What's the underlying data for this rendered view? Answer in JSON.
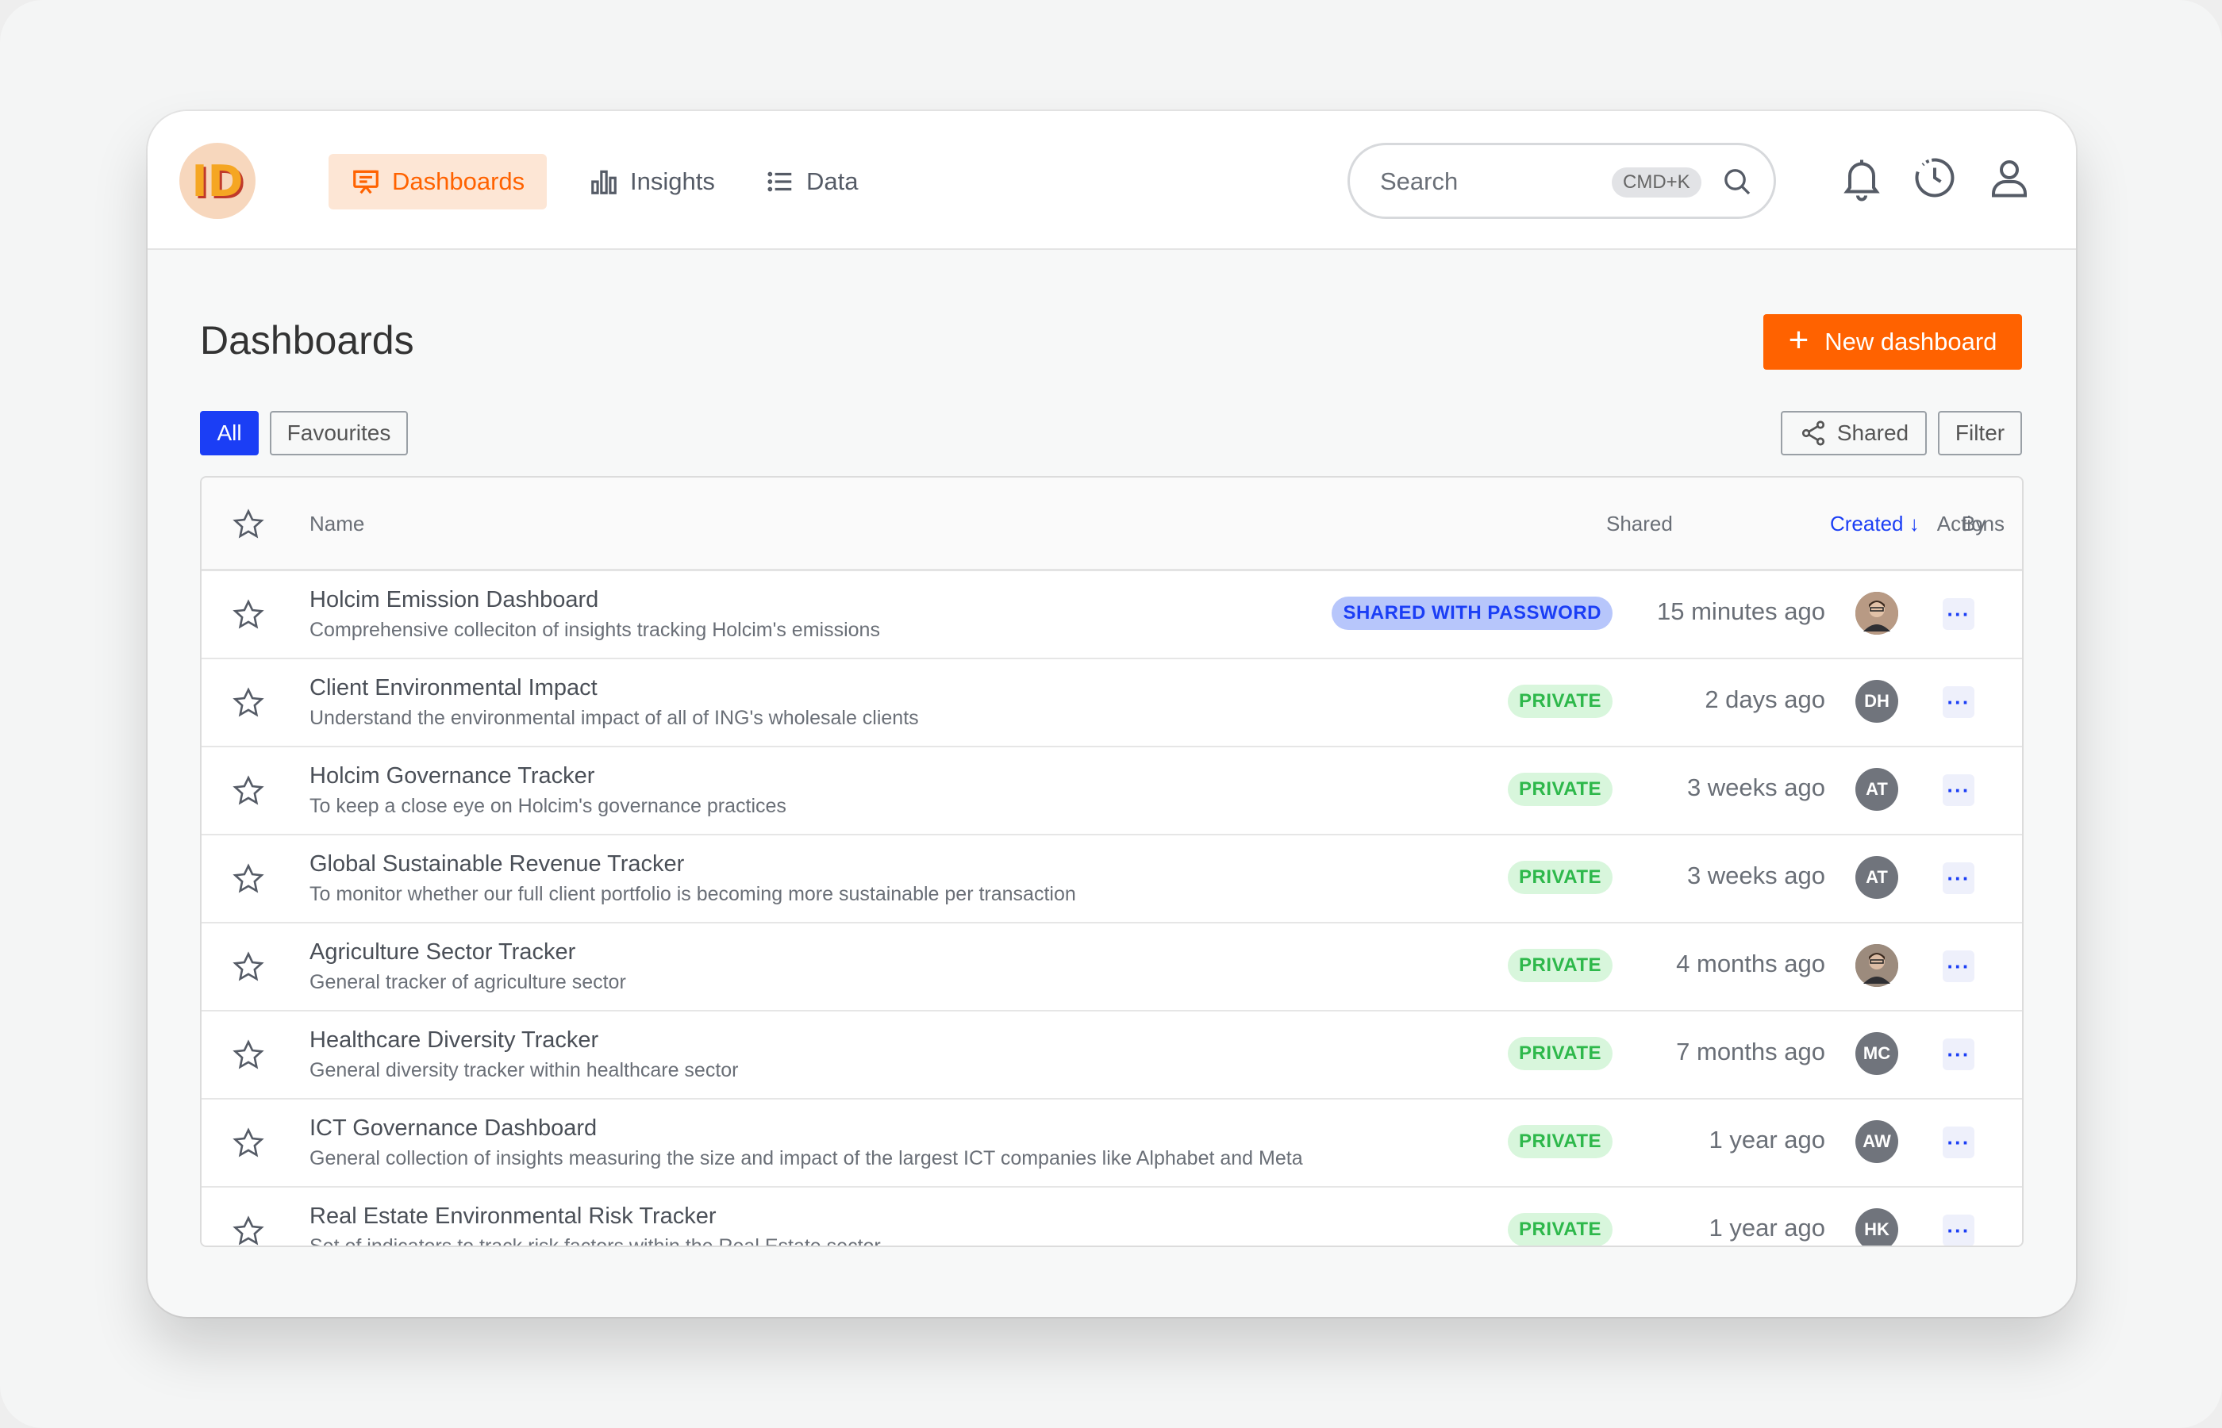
{
  "app": {
    "logo_text": "ID"
  },
  "nav": {
    "items": [
      {
        "label": "Dashboards",
        "icon": "presentation-icon",
        "active": true
      },
      {
        "label": "Insights",
        "icon": "bar-chart-icon",
        "active": false
      },
      {
        "label": "Data",
        "icon": "list-icon",
        "active": false
      }
    ]
  },
  "search": {
    "placeholder": "Search",
    "shortcut": "CMD+K"
  },
  "page": {
    "title": "Dashboards",
    "new_button": "New dashboard",
    "filters": {
      "all": "All",
      "favourites": "Favourites",
      "shared": "Shared",
      "filter": "Filter"
    }
  },
  "table": {
    "columns": {
      "name": "Name",
      "shared": "Shared",
      "created": "Created",
      "by": "By",
      "actions": "Actions"
    },
    "sort": {
      "column": "Created",
      "direction": "descending"
    },
    "rows": [
      {
        "title": "Holcim Emission Dashboard",
        "desc": "Comprehensive colleciton of insights tracking Holcim's emissions",
        "shared": "SHARED WITH PASSWORD",
        "created": "15 minutes ago",
        "by": ""
      },
      {
        "title": "Client Environmental Impact",
        "desc": "Understand the environmental impact of all of ING's wholesale clients",
        "shared": "PRIVATE",
        "created": "2 days ago",
        "by": "DH"
      },
      {
        "title": "Holcim Governance Tracker",
        "desc": "To keep a close eye on Holcim's governance practices",
        "shared": "PRIVATE",
        "created": "3 weeks ago",
        "by": "AT"
      },
      {
        "title": "Global Sustainable Revenue Tracker",
        "desc": "To monitor whether our full client portfolio is becoming more sustainable per transaction",
        "shared": "PRIVATE",
        "created": "3 weeks ago",
        "by": "AT"
      },
      {
        "title": "Agriculture Sector Tracker",
        "desc": "General tracker of agriculture sector",
        "shared": "PRIVATE",
        "created": "4 months ago",
        "by": ""
      },
      {
        "title": "Healthcare Diversity Tracker",
        "desc": "General diversity tracker within healthcare sector",
        "shared": "PRIVATE",
        "created": "7 months ago",
        "by": "MC"
      },
      {
        "title": "ICT Governance Dashboard",
        "desc": "General collection of insights  measuring the size and impact of the largest ICT companies like Alphabet and Meta",
        "shared": "PRIVATE",
        "created": "1 year ago",
        "by": "AW"
      },
      {
        "title": "Real Estate Environmental Risk Tracker",
        "desc": "Set of indicators to track risk factors within the Real Estate sector",
        "shared": "PRIVATE",
        "created": "1 year ago",
        "by": "HK"
      }
    ],
    "more_label": "···"
  },
  "colors": {
    "accent": "#ff6200",
    "primary": "#1b3ef5",
    "private_green": "#2eb84b"
  }
}
